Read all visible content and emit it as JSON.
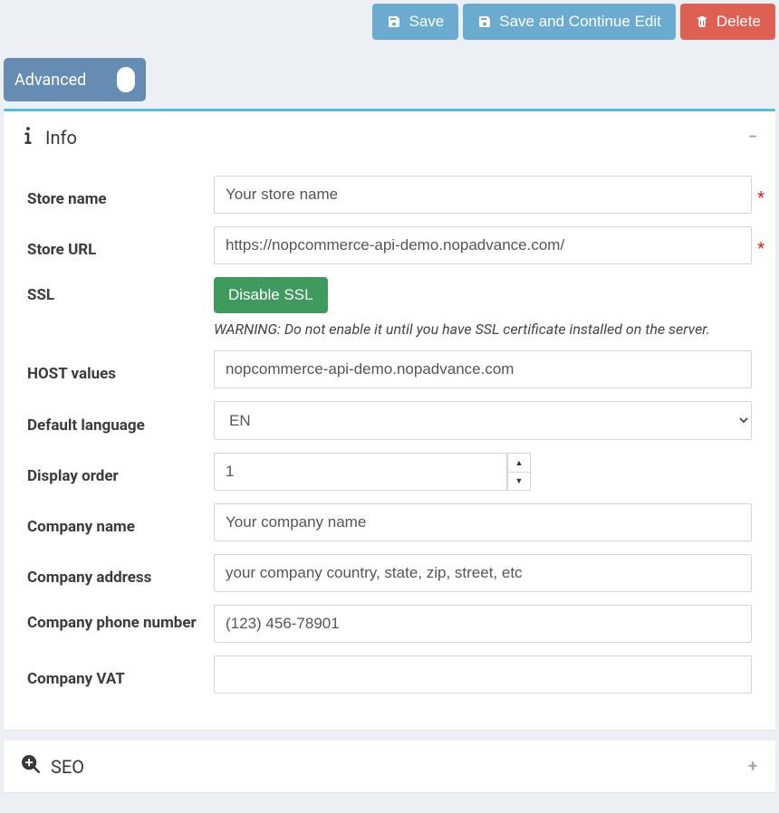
{
  "toolbar": {
    "save": "Save",
    "save_continue": "Save and Continue Edit",
    "delete": "Delete"
  },
  "advanced": {
    "label": "Advanced"
  },
  "panels": {
    "info": {
      "title": "Info"
    },
    "seo": {
      "title": "SEO"
    }
  },
  "form": {
    "store_name": {
      "label": "Store name",
      "value": "Your store name"
    },
    "store_url": {
      "label": "Store URL",
      "value": "https://nopcommerce-api-demo.nopadvance.com/"
    },
    "ssl": {
      "label": "SSL",
      "button": "Disable SSL",
      "warning": "WARNING: Do not enable it until you have SSL certificate installed on the server."
    },
    "host_values": {
      "label": "HOST values",
      "value": "nopcommerce-api-demo.nopadvance.com"
    },
    "default_language": {
      "label": "Default language",
      "value": "EN"
    },
    "display_order": {
      "label": "Display order",
      "value": "1"
    },
    "company_name": {
      "label": "Company name",
      "value": "Your company name"
    },
    "company_address": {
      "label": "Company address",
      "value": "your company country, state, zip, street, etc"
    },
    "company_phone": {
      "label": "Company phone number",
      "value": "(123) 456-78901"
    },
    "company_vat": {
      "label": "Company VAT",
      "value": ""
    }
  }
}
